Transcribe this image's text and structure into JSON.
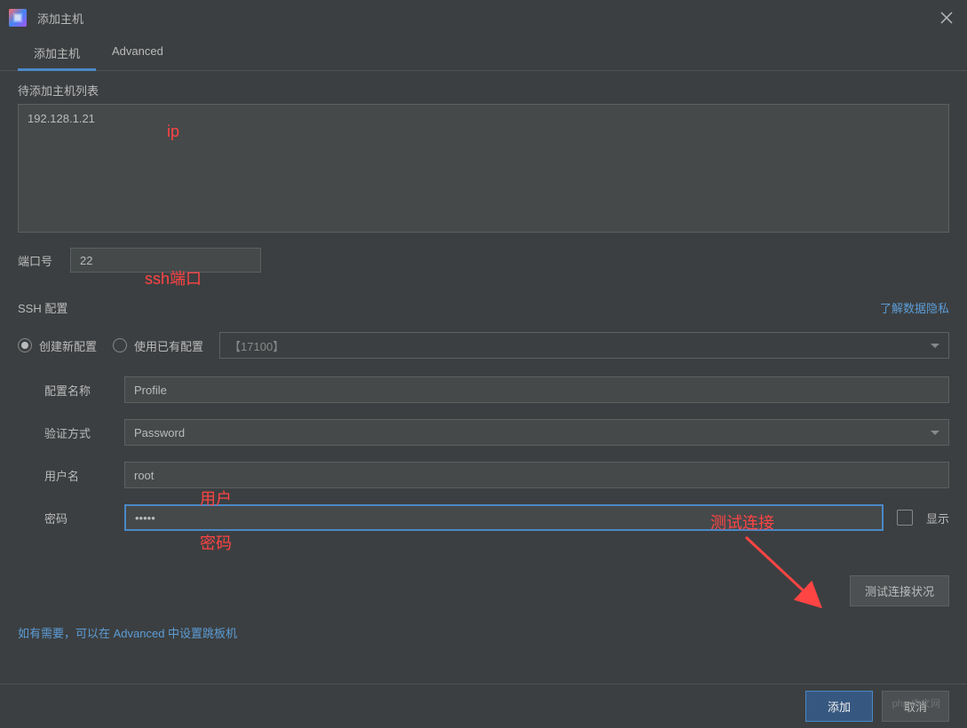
{
  "window": {
    "title": "添加主机"
  },
  "tabs": {
    "add_host": "添加主机",
    "advanced": "Advanced"
  },
  "host_list": {
    "label": "待添加主机列表",
    "value": "192.128.1.21"
  },
  "port": {
    "label": "端口号",
    "value": "22"
  },
  "ssh": {
    "title": "SSH 配置",
    "privacy_link": "了解数据隐私",
    "radio_new": "创建新配置",
    "radio_existing": "使用已有配置",
    "profile_select": "【17100】"
  },
  "form": {
    "profile_name_label": "配置名称",
    "profile_name_value": "Profile",
    "auth_type_label": "验证方式",
    "auth_type_value": "Password",
    "username_label": "用户名",
    "username_value": "root",
    "password_label": "密码",
    "password_value": "•••••",
    "show_label": "显示"
  },
  "test_button": "测试连接状况",
  "hint": "如有需要，可以在 Advanced 中设置跳板机",
  "footer": {
    "add": "添加",
    "cancel": "取消"
  },
  "annotations": {
    "ip": "ip",
    "ssh_port": "ssh端口",
    "user": "用户",
    "password": "密码",
    "test": "测试连接"
  },
  "watermark": "php 中文网"
}
